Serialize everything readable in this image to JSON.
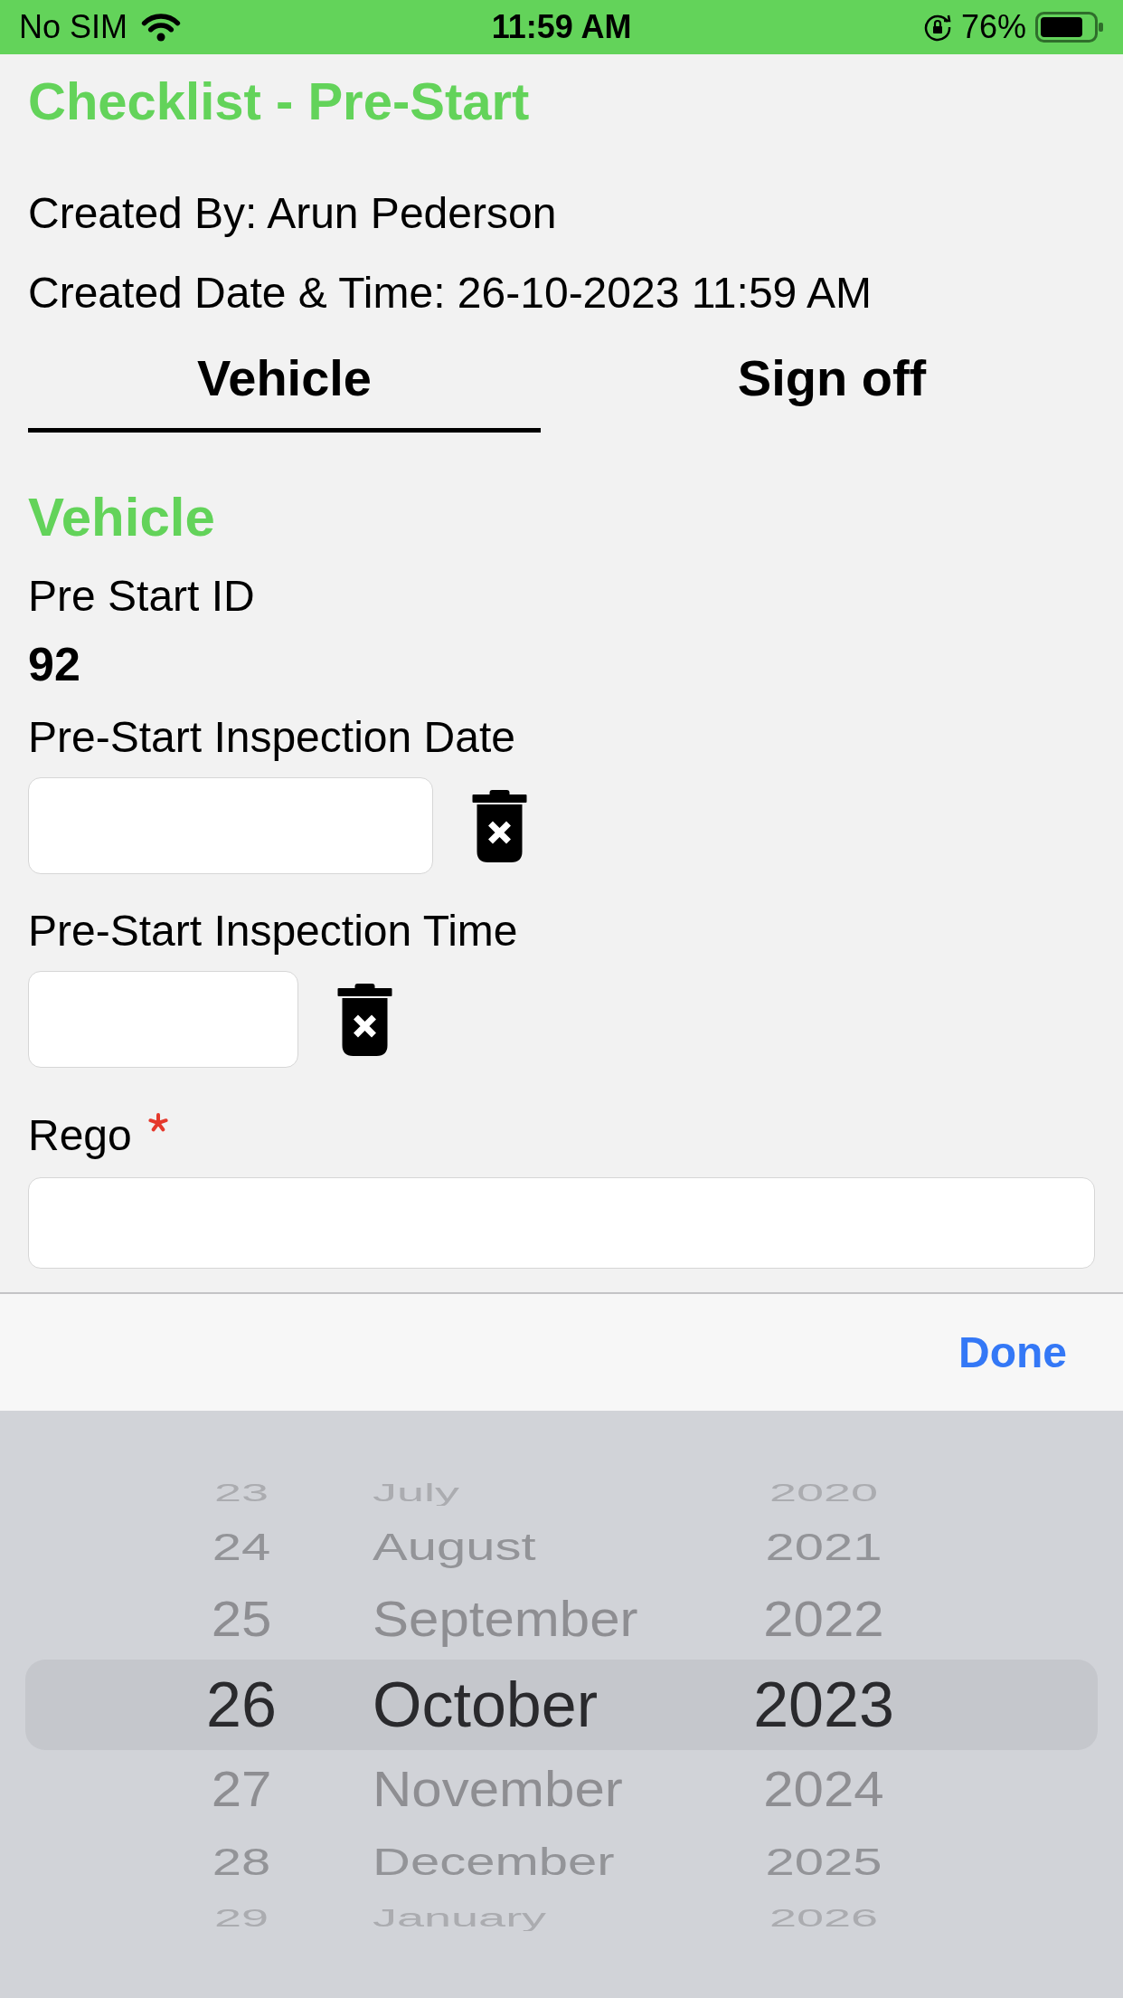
{
  "status_bar": {
    "carrier": "No SIM",
    "time": "11:59 AM",
    "battery": "76%"
  },
  "header": {
    "title": "Checklist - Pre-Start",
    "created_by": "Created By: Arun Pederson",
    "created_at": "Created Date & Time: 26-10-2023 11:59 AM"
  },
  "tabs": [
    {
      "label": "Vehicle",
      "selected": true
    },
    {
      "label": "Sign off",
      "selected": false
    }
  ],
  "section": {
    "title": "Vehicle",
    "fields": [
      {
        "kind": "readonly",
        "label": "Pre Start ID",
        "value": "92",
        "required": false,
        "clear_button": false
      },
      {
        "kind": "date",
        "label": "Pre-Start Inspection Date",
        "required": false,
        "clear_button": true
      },
      {
        "kind": "time",
        "label": "Pre-Start Inspection Time",
        "required": false,
        "clear_button": true
      },
      {
        "kind": "text",
        "label": "Rego",
        "required": true,
        "clear_button": false
      }
    ]
  },
  "keyboard_toolbar": {
    "done_button": "Done"
  },
  "date_picker": {
    "rows": [
      {
        "day": "23",
        "month": "July",
        "year": "2020",
        "selected": false
      },
      {
        "day": "24",
        "month": "August",
        "year": "2021",
        "selected": false
      },
      {
        "day": "25",
        "month": "September",
        "year": "2022",
        "selected": false
      },
      {
        "day": "26",
        "month": "October",
        "year": "2023",
        "selected": true
      },
      {
        "day": "27",
        "month": "November",
        "year": "2024",
        "selected": false
      },
      {
        "day": "28",
        "month": "December",
        "year": "2025",
        "selected": false
      },
      {
        "day": "29",
        "month": "January",
        "year": "2026",
        "selected": false
      }
    ]
  }
}
